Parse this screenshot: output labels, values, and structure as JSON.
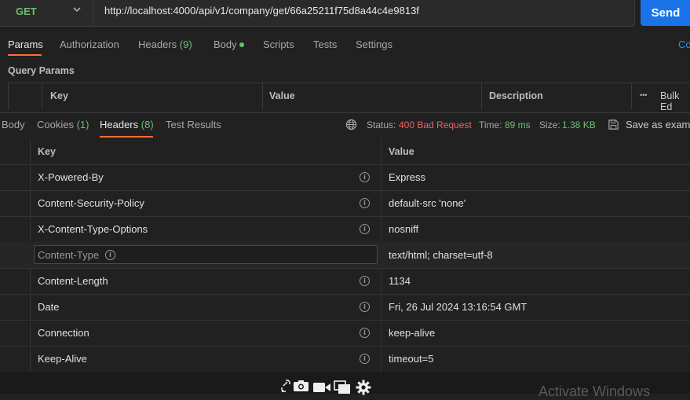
{
  "request": {
    "method": "GET",
    "url": "http://localhost:4000/api/v1/company/get/66a25211f75d8a44c4e9813f",
    "send_label": "Send"
  },
  "request_tabs": {
    "params": "Params",
    "authorization": "Authorization",
    "headers": "Headers",
    "headers_count": "(9)",
    "body": "Body",
    "scripts": "Scripts",
    "tests": "Tests",
    "settings": "Settings",
    "cookies": "Co"
  },
  "query_params": {
    "title": "Query Params",
    "columns": [
      "Key",
      "Value",
      "Description"
    ],
    "bulk_edit": "Bulk Ed",
    "more": "•••"
  },
  "response": {
    "tabs": {
      "body": "Body",
      "cookies": "Cookies",
      "cookies_count": "(1)",
      "headers": "Headers",
      "headers_count": "(8)",
      "test_results": "Test Results"
    },
    "status_label": "Status:",
    "status_value": "400 Bad Request",
    "time_label": "Time:",
    "time_value": "89 ms",
    "size_label": "Size:",
    "size_value": "1.38 KB",
    "save_label": "Save as examp",
    "headers_table": {
      "key_header": "Key",
      "value_header": "Value",
      "rows": [
        {
          "key": "X-Powered-By",
          "value": "Express"
        },
        {
          "key": "Content-Security-Policy",
          "value": "default-src 'none'"
        },
        {
          "key": "X-Content-Type-Options",
          "value": "nosniff"
        },
        {
          "key": "Content-Type",
          "value": "text/html; charset=utf-8"
        },
        {
          "key": "Content-Length",
          "value": "1134"
        },
        {
          "key": "Date",
          "value": "Fri, 26 Jul 2024 13:16:54 GMT"
        },
        {
          "key": "Connection",
          "value": "keep-alive"
        },
        {
          "key": "Keep-Alive",
          "value": "timeout=5"
        }
      ]
    }
  },
  "watermark": "Activate Windows",
  "info_glyph": "i"
}
